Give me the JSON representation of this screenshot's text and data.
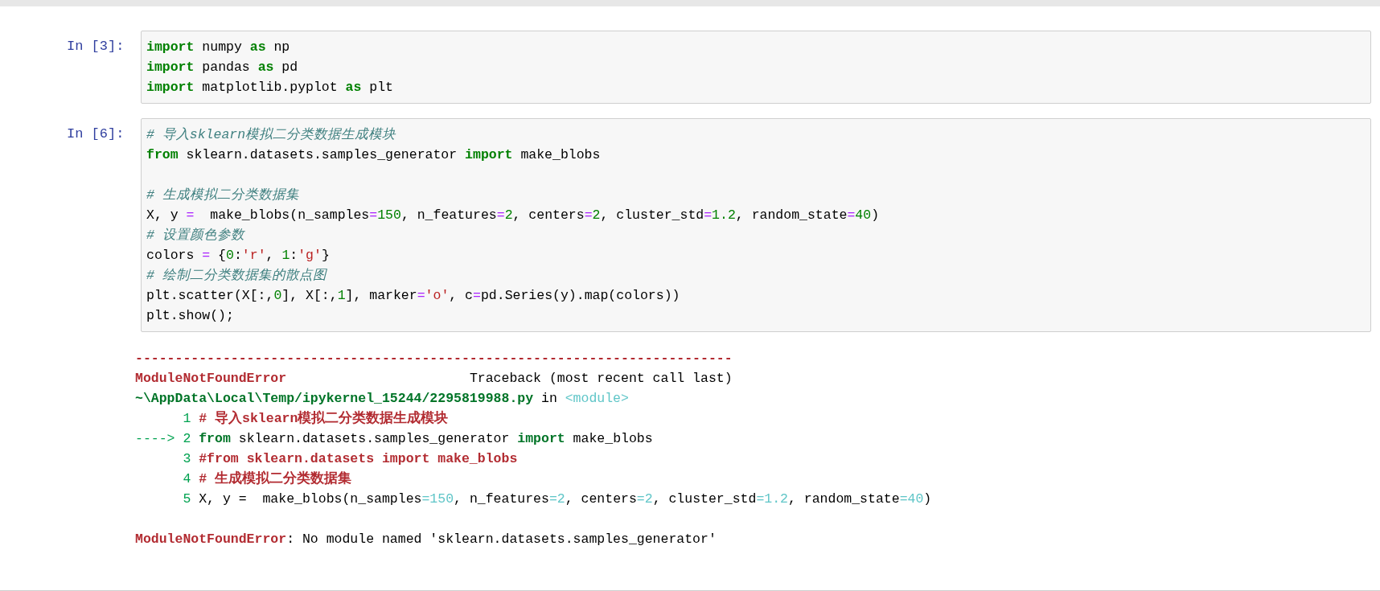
{
  "cells": [
    {
      "prompt": "In [3]:",
      "lines": [
        {
          "kind": "code",
          "tokens": [
            {
              "kind": "kw",
              "text": "import"
            },
            {
              "kind": "pl",
              "text": " numpy "
            },
            {
              "kind": "kw",
              "text": "as"
            },
            {
              "kind": "pl",
              "text": " np"
            }
          ]
        },
        {
          "kind": "code",
          "tokens": [
            {
              "kind": "kw",
              "text": "import"
            },
            {
              "kind": "pl",
              "text": " pandas "
            },
            {
              "kind": "kw",
              "text": "as"
            },
            {
              "kind": "pl",
              "text": " pd"
            }
          ]
        },
        {
          "kind": "code",
          "tokens": [
            {
              "kind": "kw",
              "text": "import"
            },
            {
              "kind": "pl",
              "text": " matplotlib.pyplot "
            },
            {
              "kind": "kw",
              "text": "as"
            },
            {
              "kind": "pl",
              "text": " plt"
            }
          ]
        }
      ]
    },
    {
      "prompt": "In [6]:",
      "lines": [
        {
          "kind": "code",
          "tokens": [
            {
              "kind": "cm",
              "text": "# 导入sklearn模拟二分类数据生成模块"
            }
          ]
        },
        {
          "kind": "code",
          "tokens": [
            {
              "kind": "kw",
              "text": "from"
            },
            {
              "kind": "pl",
              "text": " sklearn.datasets.samples_generator "
            },
            {
              "kind": "kw",
              "text": "import"
            },
            {
              "kind": "pl",
              "text": " make_blobs"
            }
          ]
        },
        {
          "kind": "blank"
        },
        {
          "kind": "code",
          "tokens": [
            {
              "kind": "cm",
              "text": "# 生成模拟二分类数据集"
            }
          ]
        },
        {
          "kind": "code",
          "tokens": [
            {
              "kind": "pl",
              "text": "X, y "
            },
            {
              "kind": "op",
              "text": "="
            },
            {
              "kind": "pl",
              "text": "  make_blobs(n_samples"
            },
            {
              "kind": "op",
              "text": "="
            },
            {
              "kind": "num",
              "text": "150"
            },
            {
              "kind": "pl",
              "text": ", n_features"
            },
            {
              "kind": "op",
              "text": "="
            },
            {
              "kind": "num",
              "text": "2"
            },
            {
              "kind": "pl",
              "text": ", centers"
            },
            {
              "kind": "op",
              "text": "="
            },
            {
              "kind": "num",
              "text": "2"
            },
            {
              "kind": "pl",
              "text": ", cluster_std"
            },
            {
              "kind": "op",
              "text": "="
            },
            {
              "kind": "num",
              "text": "1.2"
            },
            {
              "kind": "pl",
              "text": ", random_state"
            },
            {
              "kind": "op",
              "text": "="
            },
            {
              "kind": "num",
              "text": "40"
            },
            {
              "kind": "pl",
              "text": ")"
            }
          ]
        },
        {
          "kind": "code",
          "tokens": [
            {
              "kind": "cm",
              "text": "# 设置颜色参数"
            }
          ]
        },
        {
          "kind": "code",
          "tokens": [
            {
              "kind": "pl",
              "text": "colors "
            },
            {
              "kind": "op",
              "text": "="
            },
            {
              "kind": "pl",
              "text": " {"
            },
            {
              "kind": "num",
              "text": "0"
            },
            {
              "kind": "pl",
              "text": ":"
            },
            {
              "kind": "str",
              "text": "'r'"
            },
            {
              "kind": "pl",
              "text": ", "
            },
            {
              "kind": "num",
              "text": "1"
            },
            {
              "kind": "pl",
              "text": ":"
            },
            {
              "kind": "str",
              "text": "'g'"
            },
            {
              "kind": "pl",
              "text": "}"
            }
          ]
        },
        {
          "kind": "code",
          "tokens": [
            {
              "kind": "cm",
              "text": "# 绘制二分类数据集的散点图"
            }
          ]
        },
        {
          "kind": "code",
          "tokens": [
            {
              "kind": "pl",
              "text": "plt.scatter(X[:,"
            },
            {
              "kind": "num",
              "text": "0"
            },
            {
              "kind": "pl",
              "text": "], X[:,"
            },
            {
              "kind": "num",
              "text": "1"
            },
            {
              "kind": "pl",
              "text": "], marker"
            },
            {
              "kind": "op",
              "text": "="
            },
            {
              "kind": "str",
              "text": "'o'"
            },
            {
              "kind": "pl",
              "text": ", c"
            },
            {
              "kind": "op",
              "text": "="
            },
            {
              "kind": "pl",
              "text": "pd.Series(y).map(colors))"
            }
          ]
        },
        {
          "kind": "code",
          "tokens": [
            {
              "kind": "pl",
              "text": "plt.show();"
            }
          ]
        }
      ],
      "output": [
        {
          "kind": "code",
          "tokens": [
            {
              "kind": "err",
              "text": "---------------------------------------------------------------------------"
            }
          ]
        },
        {
          "kind": "code",
          "tokens": [
            {
              "kind": "err",
              "text": "ModuleNotFoundError"
            },
            {
              "kind": "pl",
              "text": "                       Traceback (most recent call last)"
            }
          ]
        },
        {
          "kind": "code",
          "tokens": [
            {
              "kind": "ok",
              "text": "~\\AppData\\Local\\Temp/ipykernel_15244/2295819988.py"
            },
            {
              "kind": "pl",
              "text": " in "
            },
            {
              "kind": "cy",
              "text": "<module>"
            }
          ]
        },
        {
          "kind": "code",
          "tokens": [
            {
              "kind": "ln",
              "text": "      1 "
            },
            {
              "kind": "err",
              "text": "# 导入sklearn模拟二分类数据生成模块"
            }
          ]
        },
        {
          "kind": "code",
          "tokens": [
            {
              "kind": "ln",
              "text": "----> 2 "
            },
            {
              "kind": "ok",
              "text": "from"
            },
            {
              "kind": "pl",
              "text": " sklearn.datasets.samples_generator "
            },
            {
              "kind": "ok",
              "text": "import"
            },
            {
              "kind": "pl",
              "text": " make_blobs"
            }
          ]
        },
        {
          "kind": "code",
          "tokens": [
            {
              "kind": "ln",
              "text": "      3 "
            },
            {
              "kind": "err",
              "text": "#from sklearn.datasets import make_blobs"
            }
          ]
        },
        {
          "kind": "code",
          "tokens": [
            {
              "kind": "ln",
              "text": "      4 "
            },
            {
              "kind": "err",
              "text": "# 生成模拟二分类数据集"
            }
          ]
        },
        {
          "kind": "code",
          "tokens": [
            {
              "kind": "ln",
              "text": "      5 "
            },
            {
              "kind": "pl",
              "text": "X, y =  make_blobs(n_samples"
            },
            {
              "kind": "cy",
              "text": "=150"
            },
            {
              "kind": "pl",
              "text": ", n_features"
            },
            {
              "kind": "cy",
              "text": "=2"
            },
            {
              "kind": "pl",
              "text": ", centers"
            },
            {
              "kind": "cy",
              "text": "=2"
            },
            {
              "kind": "pl",
              "text": ", cluster_std"
            },
            {
              "kind": "cy",
              "text": "=1.2"
            },
            {
              "kind": "pl",
              "text": ", random_state"
            },
            {
              "kind": "cy",
              "text": "=40"
            },
            {
              "kind": "pl",
              "text": ")"
            }
          ]
        },
        {
          "kind": "blank"
        },
        {
          "kind": "code",
          "tokens": [
            {
              "kind": "err",
              "text": "ModuleNotFoundError"
            },
            {
              "kind": "pl",
              "text": ": No module named 'sklearn.datasets.samples_generator'"
            }
          ]
        }
      ]
    }
  ]
}
